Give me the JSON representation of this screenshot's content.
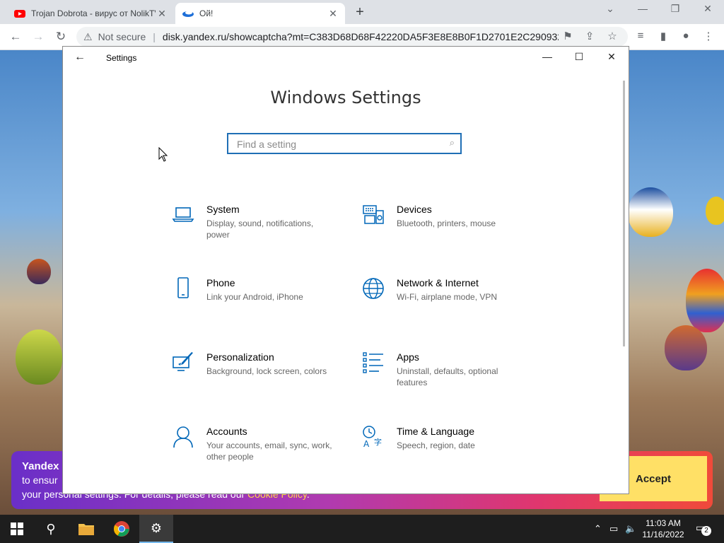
{
  "browser": {
    "tabs": [
      {
        "title": "Trojan Dobrota - вирус от NolikTV"
      },
      {
        "title": "Ой!"
      }
    ],
    "security": "Not secure",
    "url": "disk.yandex.ru/showcaptcha?mt=C383D68D68F42220DA5F3E8E8B0F1D2701E2C290932..."
  },
  "cookie_banner": {
    "title": "Yandex",
    "line2": "to ensur",
    "line3_text": "your personal settings. For details, please read our",
    "link": "Cookie Policy",
    "line3_end": ".",
    "accept": "Accept"
  },
  "settings": {
    "window_title": "Settings",
    "heading": "Windows Settings",
    "search_placeholder": "Find a setting",
    "items": [
      {
        "name": "System",
        "desc": "Display, sound, notifications, power",
        "icon": "laptop-icon"
      },
      {
        "name": "Devices",
        "desc": "Bluetooth, printers, mouse",
        "icon": "keyboard-devices-icon"
      },
      {
        "name": "Phone",
        "desc": "Link your Android, iPhone",
        "icon": "phone-icon"
      },
      {
        "name": "Network & Internet",
        "desc": "Wi-Fi, airplane mode, VPN",
        "icon": "globe-icon"
      },
      {
        "name": "Personalization",
        "desc": "Background, lock screen, colors",
        "icon": "paint-brush-icon"
      },
      {
        "name": "Apps",
        "desc": "Uninstall, defaults, optional features",
        "icon": "apps-list-icon"
      },
      {
        "name": "Accounts",
        "desc": "Your accounts, email, sync, work, other people",
        "icon": "person-icon"
      },
      {
        "name": "Time & Language",
        "desc": "Speech, region, date",
        "icon": "time-language-icon"
      }
    ],
    "accent": "#0067b8"
  },
  "taskbar": {
    "time": "11:03 AM",
    "date": "11/16/2022",
    "notifications": "2"
  }
}
